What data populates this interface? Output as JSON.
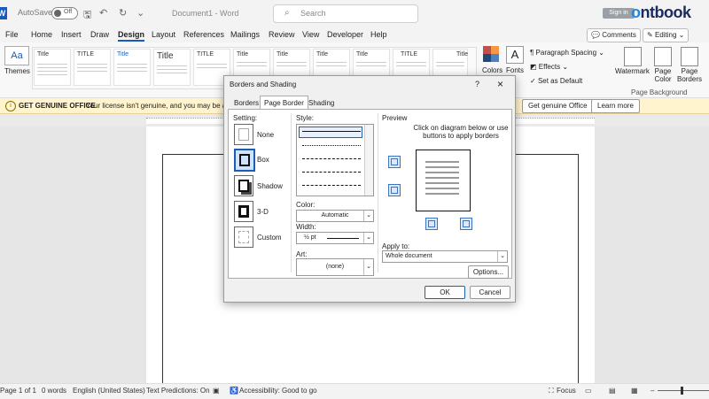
{
  "app": {
    "autosave_label": "AutoSave",
    "autosave_state": "Off",
    "doc_title": "Document1 - Word",
    "search_placeholder": "Search",
    "sign_in": "Sign in",
    "brand": "ntbook",
    "brand_o": "o"
  },
  "menu": {
    "items": [
      "File",
      "Home",
      "Insert",
      "Draw",
      "Design",
      "Layout",
      "References",
      "Mailings",
      "Review",
      "View",
      "Developer",
      "Help"
    ],
    "active": "Design",
    "comments": "Comments",
    "editing": "Editing"
  },
  "ribbon": {
    "themes": "Themes",
    "style_titles": [
      "Title",
      "TITLE",
      "Title",
      "Title",
      "TITLE",
      "Title",
      "Title",
      "Title",
      "Title",
      "TITLE",
      "Title"
    ],
    "colors": "Colors",
    "fonts": "Fonts",
    "paragraph_spacing": "Paragraph Spacing",
    "effects": "Effects",
    "set_as_default": "Set as Default",
    "watermark": "Watermark",
    "page_color": "Page Color",
    "page_borders": "Page Borders",
    "page_background": "Page Background"
  },
  "banner": {
    "label": "GET GENUINE OFFICE",
    "message": "Your license isn't genuine, and you may be a vi",
    "get_genuine": "Get genuine Office",
    "learn_more": "Learn more"
  },
  "status": {
    "page": "Page 1 of 1",
    "words": "0 words",
    "language": "English (United States)",
    "predictions": "Text Predictions: On",
    "accessibility": "Accessibility: Good to go",
    "focus": "Focus"
  },
  "dialog": {
    "title": "Borders and Shading",
    "help": "?",
    "close": "×",
    "tabs": [
      "Borders",
      "Page Border",
      "Shading"
    ],
    "active_tab": "Page Border",
    "setting_label": "Setting:",
    "settings": [
      "None",
      "Box",
      "Shadow",
      "3-D",
      "Custom"
    ],
    "selected_setting": "Box",
    "style_label": "Style:",
    "color_label": "Color:",
    "color_value": "Automatic",
    "width_label": "Width:",
    "width_value": "½ pt",
    "art_label": "Art:",
    "art_value": "(none)",
    "preview_label": "Preview",
    "preview_hint": "Click on diagram below or use buttons to apply borders",
    "apply_to_label": "Apply to:",
    "apply_to_value": "Whole document",
    "options": "Options...",
    "ok": "OK",
    "cancel": "Cancel"
  }
}
